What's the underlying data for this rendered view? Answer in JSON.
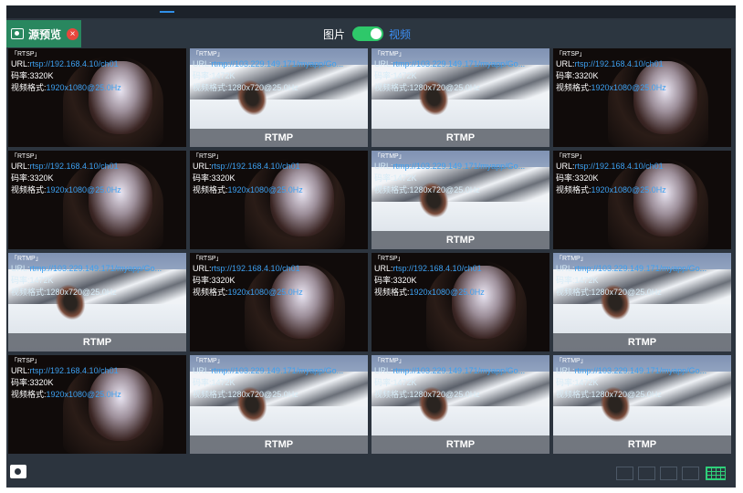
{
  "header": {
    "source_preview_label": "源预览",
    "mode_picture_label": "图片",
    "mode_video_label": "视频",
    "mode_toggle_on": true
  },
  "tiles": [
    {
      "type": "rtsp",
      "tag": "「RTSP」",
      "url_prefix": "URL:",
      "url": "rtsp://192.168.4.10/ch01",
      "bitrate": "码率:3320K",
      "format_prefix": "视频格式:",
      "format": "1920x1080@25.0Hz",
      "caption": ""
    },
    {
      "type": "rtmp",
      "tag": "「RTMP」",
      "url_prefix": "URL:",
      "url": "rtmp://103.229.149.171/myapp/Go...",
      "bitrate": "码率:1472K",
      "format_prefix": "视频格式:",
      "format": "1280x720@25.0Hz",
      "caption": "RTMP"
    },
    {
      "type": "rtmp",
      "tag": "「RTMP」",
      "url_prefix": "URL:",
      "url": "rtmp://103.229.149.171/myapp/Go...",
      "bitrate": "码率:1472K",
      "format_prefix": "视频格式:",
      "format": "1280x720@25.0Hz",
      "caption": "RTMP"
    },
    {
      "type": "rtsp",
      "tag": "「RTSP」",
      "url_prefix": "URL:",
      "url": "rtsp://192.168.4.10/ch01",
      "bitrate": "码率:3320K",
      "format_prefix": "视频格式:",
      "format": "1920x1080@25.0Hz",
      "caption": ""
    },
    {
      "type": "rtsp",
      "tag": "「RTSP」",
      "url_prefix": "URL:",
      "url": "rtsp://192.168.4.10/ch01",
      "bitrate": "码率:3320K",
      "format_prefix": "视频格式:",
      "format": "1920x1080@25.0Hz",
      "caption": ""
    },
    {
      "type": "rtsp",
      "tag": "「RTSP」",
      "url_prefix": "URL:",
      "url": "rtsp://192.168.4.10/ch01",
      "bitrate": "码率:3320K",
      "format_prefix": "视频格式:",
      "format": "1920x1080@25.0Hz",
      "caption": ""
    },
    {
      "type": "rtmp",
      "tag": "「RTMP」",
      "url_prefix": "URL:",
      "url": "rtmp://103.229.149.171/myapp/Go...",
      "bitrate": "码率:1472K",
      "format_prefix": "视频格式:",
      "format": "1280x720@25.0Hz",
      "caption": "RTMP"
    },
    {
      "type": "rtsp",
      "tag": "「RTSP」",
      "url_prefix": "URL:",
      "url": "rtsp://192.168.4.10/ch01",
      "bitrate": "码率:3320K",
      "format_prefix": "视频格式:",
      "format": "1920x1080@25.0Hz",
      "caption": ""
    },
    {
      "type": "rtmp",
      "tag": "「RTMP」",
      "url_prefix": "URL:",
      "url": "rtmp://103.229.149.171/myapp/Go...",
      "bitrate": "码率:1472K",
      "format_prefix": "视频格式:",
      "format": "1280x720@25.0Hz",
      "caption": "RTMP"
    },
    {
      "type": "rtsp",
      "tag": "「RTSP」",
      "url_prefix": "URL:",
      "url": "rtsp://192.168.4.10/ch01",
      "bitrate": "码率:3320K",
      "format_prefix": "视频格式:",
      "format": "1920x1080@25.0Hz",
      "caption": ""
    },
    {
      "type": "rtsp",
      "tag": "「RTSP」",
      "url_prefix": "URL:",
      "url": "rtsp://192.168.4.10/ch01",
      "bitrate": "码率:3320K",
      "format_prefix": "视频格式:",
      "format": "1920x1080@25.0Hz",
      "caption": ""
    },
    {
      "type": "rtmp",
      "tag": "「RTMP」",
      "url_prefix": "URL:",
      "url": "rtmp://103.229.149.171/myapp/Go...",
      "bitrate": "码率:1472K",
      "format_prefix": "视频格式:",
      "format": "1280x720@25.0Hz",
      "caption": "RTMP"
    },
    {
      "type": "rtsp",
      "tag": "「RTSP」",
      "url_prefix": "URL:",
      "url": "rtsp://192.168.4.10/ch01",
      "bitrate": "码率:3320K",
      "format_prefix": "视频格式:",
      "format": "1920x1080@25.0Hz",
      "caption": ""
    },
    {
      "type": "rtmp",
      "tag": "「RTMP」",
      "url_prefix": "URL:",
      "url": "rtmp://103.229.149.171/myapp/Go...",
      "bitrate": "码率:1472K",
      "format_prefix": "视频格式:",
      "format": "1280x720@25.0Hz",
      "caption": "RTMP"
    },
    {
      "type": "rtmp",
      "tag": "「RTMP」",
      "url_prefix": "URL:",
      "url": "rtmp://103.229.149.171/myapp/Go...",
      "bitrate": "码率:1472K",
      "format_prefix": "视频格式:",
      "format": "1280x720@25.0Hz",
      "caption": "RTMP"
    },
    {
      "type": "rtmp",
      "tag": "「RTMP」",
      "url_prefix": "URL:",
      "url": "rtmp://103.229.149.171/myapp/Go...",
      "bitrate": "码率:1472K",
      "format_prefix": "视频格式:",
      "format": "1280x720@25.0Hz",
      "caption": "RTMP"
    }
  ],
  "footer": {
    "layouts": [
      "layout-1x1",
      "layout-1x2",
      "layout-2x2",
      "layout-3x3",
      "layout-4x4"
    ],
    "active_layout": "layout-4x4"
  },
  "colors": {
    "accent_green": "#29875f",
    "toggle_green": "#2ec86a",
    "link_blue": "#3d8ef5",
    "close_red": "#e8473d",
    "panel_bg": "#2c343e"
  }
}
